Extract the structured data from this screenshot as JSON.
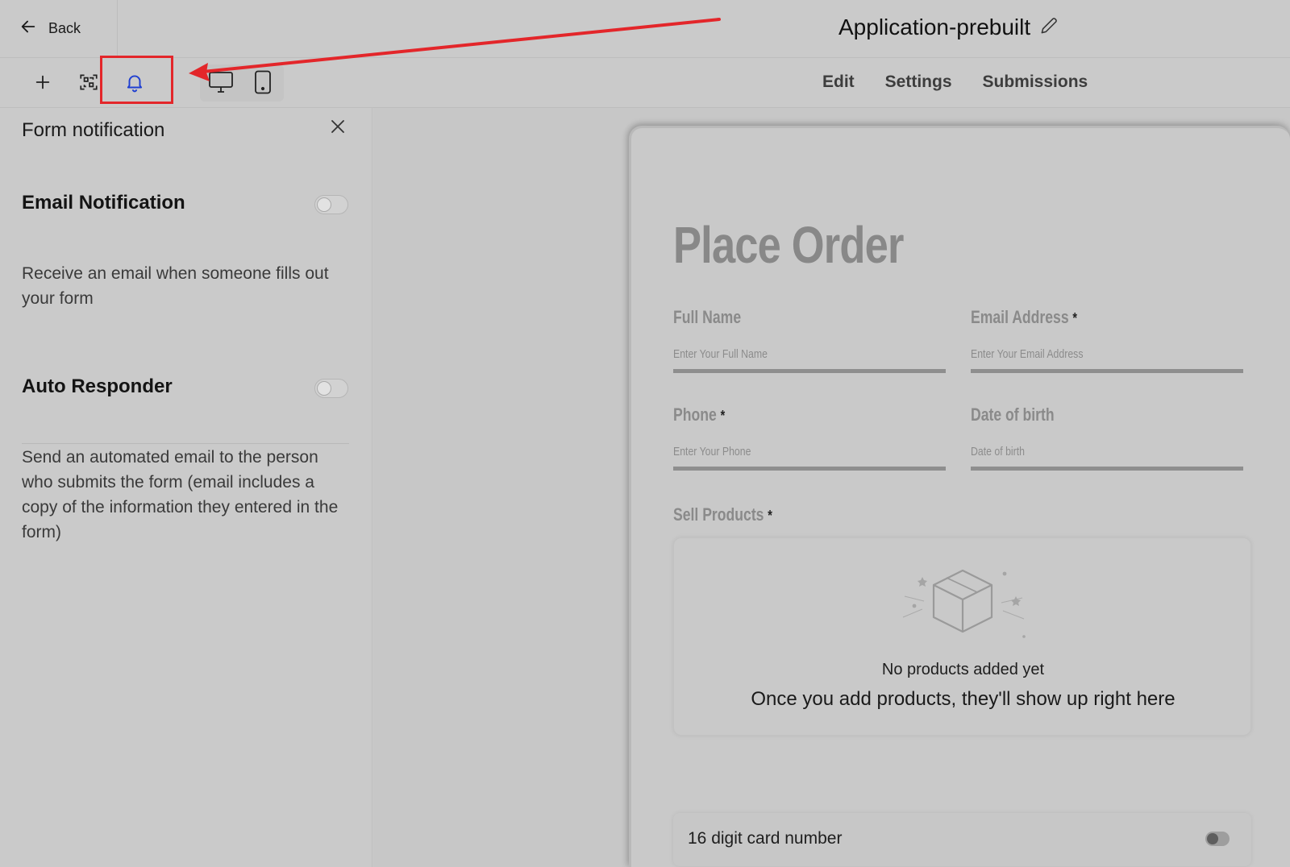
{
  "header": {
    "back_label": "Back",
    "title": "Application-prebuilt"
  },
  "toolbar": {
    "icons": [
      "plus-icon",
      "qr-scan-icon",
      "bell-icon",
      "desktop-icon",
      "mobile-icon"
    ],
    "tabs": [
      {
        "label": "Edit"
      },
      {
        "label": "Settings"
      },
      {
        "label": "Submissions"
      }
    ]
  },
  "panel": {
    "title": "Form notification",
    "email_notification": {
      "title": "Email Notification",
      "description": "Receive an email when someone fills out your form",
      "enabled": false
    },
    "auto_responder": {
      "title": "Auto Responder",
      "description": "Send an automated email to the person who submits the form (email includes a copy of the information they entered in the form)",
      "enabled": false
    }
  },
  "form": {
    "title": "Place Order",
    "fields": [
      {
        "label": "Full Name",
        "required": false,
        "placeholder": "Enter Your Full Name"
      },
      {
        "label": "Email Address",
        "required": true,
        "placeholder": "Enter Your Email Address"
      },
      {
        "label": "Phone",
        "required": true,
        "placeholder": "Enter Your Phone"
      },
      {
        "label": "Date of birth",
        "required": false,
        "placeholder": "Date of birth"
      }
    ],
    "required_marker": "*",
    "products": {
      "label": "Sell Products",
      "empty_title": "No products added yet",
      "empty_subtitle": "Once you add products, they'll show up right here"
    },
    "card_number": {
      "label": "16 digit card number",
      "enabled": false
    }
  },
  "colors": {
    "annotation": "#e3262a",
    "bell_active": "#1f3fd1",
    "background": "#cacaca"
  }
}
